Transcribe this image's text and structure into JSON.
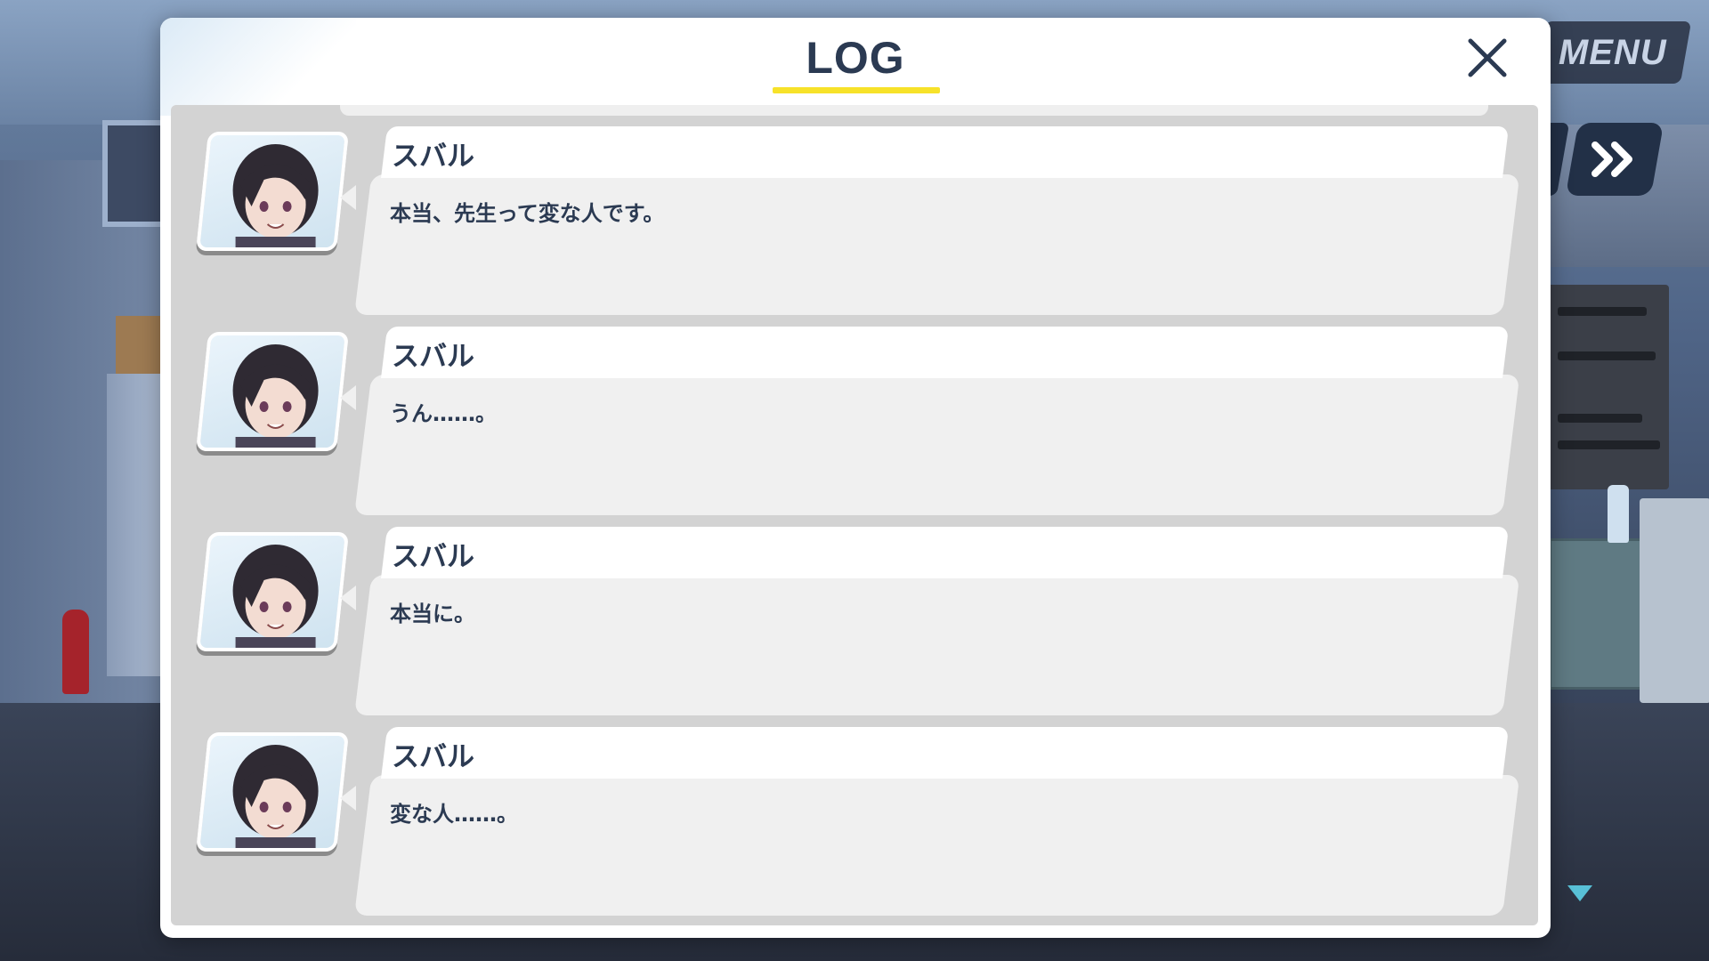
{
  "window": {
    "title": "LOG"
  },
  "hud": {
    "menu_label": "MENU",
    "skip_icon": "fast-forward-icon",
    "scroll_icon": "triangle-down-icon"
  },
  "log": {
    "entries": [
      {
        "speaker": "スバル",
        "text": "本当、先生って変な人です。"
      },
      {
        "speaker": "スバル",
        "text": "うん……。"
      },
      {
        "speaker": "スバル",
        "text": "本当に。"
      },
      {
        "speaker": "スバル",
        "text": "変な人……。"
      }
    ]
  },
  "colors": {
    "title_text": "#2b3a52",
    "title_underline": "#f7e22a",
    "list_background": "#d3d3d3",
    "bubble_body": "#f0f0f0",
    "hud_button": "#223047"
  }
}
